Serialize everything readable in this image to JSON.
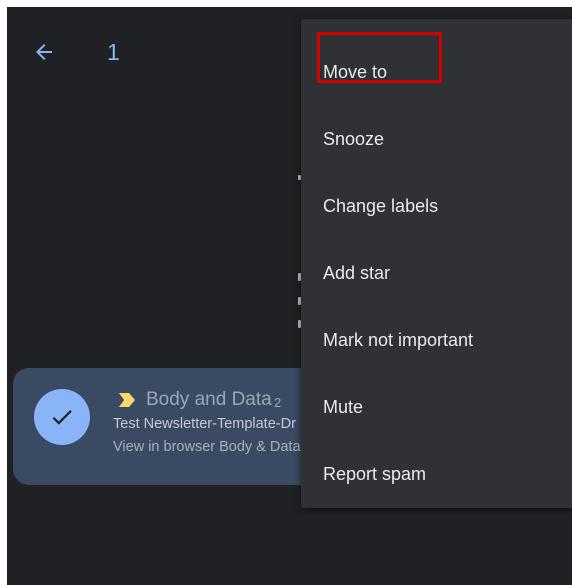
{
  "header": {
    "selected_count": "1",
    "back_icon": "arrow-back-icon"
  },
  "email": {
    "sender": "Body and Data",
    "thread_count": "2",
    "subject": "Test Newsletter-Template-Dr",
    "snippet": "View in browser Body & Data",
    "check_icon": "checkmark-icon",
    "importance_icon": "important-marker-icon",
    "importance_color": "#fdd663"
  },
  "menu": {
    "items": [
      {
        "label": "Move to"
      },
      {
        "label": "Snooze"
      },
      {
        "label": "Change labels"
      },
      {
        "label": "Add star"
      },
      {
        "label": "Mark not important"
      },
      {
        "label": "Mute"
      },
      {
        "label": "Report spam"
      }
    ]
  },
  "colors": {
    "background": "#202124",
    "menu_background": "#303134",
    "accent": "#8ab4f8",
    "selected_row": "#3b4a63",
    "highlight": "#d50000"
  }
}
